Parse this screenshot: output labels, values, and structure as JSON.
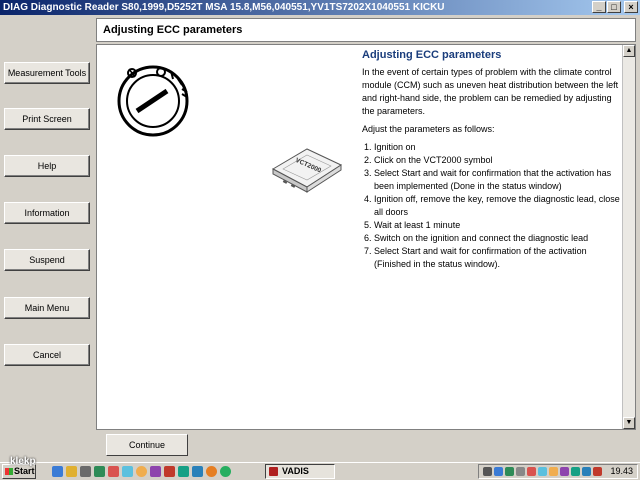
{
  "window": {
    "title": "DIAG Diagnostic Reader S80,1999,D5252T MSA 15.8,M56,040551,YV1TS7202X1040551 KICKU",
    "minimize": "_",
    "maximize": "□",
    "close": "×"
  },
  "header": {
    "title": "Adjusting ECC parameters"
  },
  "sidebar": {
    "buttons": [
      {
        "label": "Measurement Tools"
      },
      {
        "label": "Print Screen"
      },
      {
        "label": "Help"
      },
      {
        "label": "Information"
      },
      {
        "label": "Suspend"
      },
      {
        "label": "Main Menu"
      },
      {
        "label": "Cancel"
      }
    ]
  },
  "main": {
    "title": "Adjusting ECC parameters",
    "intro": "In the event of certain types of problem with the climate control module (CCM) such as uneven heat distribution between the left and right-hand side, the problem can be remedied by adjusting the parameters.",
    "adjust_text": "Adjust the parameters as follows:",
    "steps": [
      "Ignition on",
      "Click on the VCT2000 symbol",
      "Select Start and wait for confirmation that the activation has been implemented (Done in the status window)",
      "Ignition off, remove the key, remove the diagnostic lead, close all doors",
      "Wait at least 1 minute",
      "Switch on the ignition and connect the diagnostic lead",
      "Select Start and wait for confirmation of the activation (Finished in the status window)."
    ],
    "vct_label": "VCT2000"
  },
  "footer": {
    "continue_label": "Continue"
  },
  "taskbar": {
    "start_label": "Start",
    "task_label": "VADIS",
    "clock": "19.43",
    "watermark": "klekp"
  },
  "colors": {
    "title_gradient_start": "#0a246a",
    "info_title": "#1a3d7c",
    "window_bg": "#d4d0c8"
  }
}
